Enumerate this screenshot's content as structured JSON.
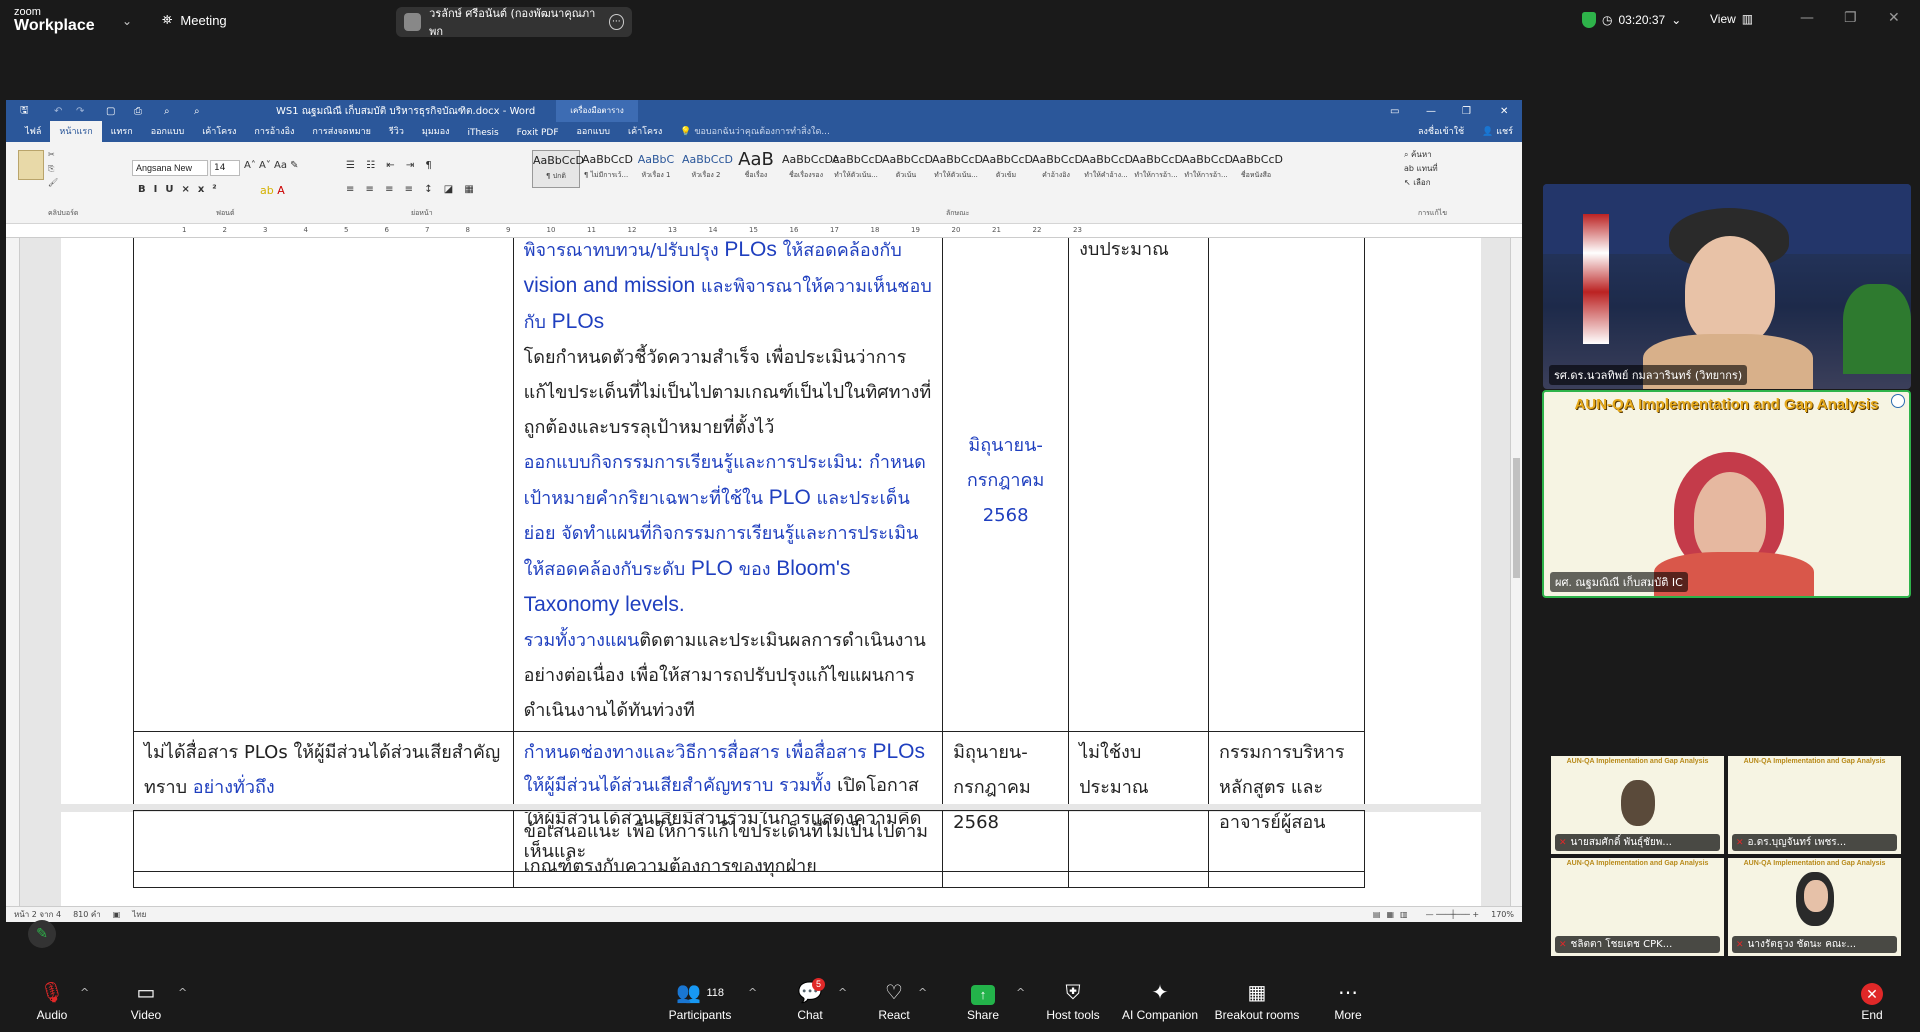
{
  "zoom": {
    "logo_line1": "zoom",
    "logo_line2": "Workplace",
    "meeting_label": "Meeting",
    "active_speaker": "วรลักษ์ ศรีอนันต์ (กองพัฒนาคุณภาพก",
    "timer": "03:20:37",
    "view_label": "View"
  },
  "word": {
    "title": "WS1 ณฐมณิณี เก็บสมบัติ บริหารธุรกิจบัณฑิต.docx  -  Word",
    "context_tab": "เครื่องมือตาราง",
    "tell_me": "ขอบอกฉันว่าคุณต้องการทำสิ่งใด...",
    "sign_in": "ลงชื่อเข้าใช้",
    "share": "แชร์",
    "tabs": [
      "ไฟล์",
      "หน้าแรก",
      "แทรก",
      "ออกแบบ",
      "เค้าโครง",
      "การอ้างอิง",
      "การส่งจดหมาย",
      "รีวิว",
      "มุมมอง",
      "iThesis",
      "Foxit PDF",
      "ออกแบบ",
      "เค้าโครง"
    ],
    "font_name": "Angsana New",
    "font_size": "14",
    "styles": [
      {
        "preview": "AaBbCcD",
        "name": "¶ ปกติ"
      },
      {
        "preview": "AaBbCcD",
        "name": "¶ ไม่มีการเว้..."
      },
      {
        "preview": "AaBbC",
        "name": "หัวเรื่อง 1"
      },
      {
        "preview": "AaBbCcD",
        "name": "หัวเรื่อง 2"
      },
      {
        "preview": "AaB",
        "name": "ชื่อเรื่อง"
      },
      {
        "preview": "AaBbCcDc",
        "name": "ชื่อเรื่องรอง"
      },
      {
        "preview": "AaBbCcD",
        "name": "ทำให้ตัวเน้น..."
      },
      {
        "preview": "AaBbCcD",
        "name": "ตัวเน้น"
      },
      {
        "preview": "AaBbCcD",
        "name": "ทำให้ตัวเน้น..."
      },
      {
        "preview": "AaBbCcD",
        "name": "ตัวเข้ม"
      },
      {
        "preview": "AaBbCcD",
        "name": "คำอ้างอิง"
      },
      {
        "preview": "AaBbCcD",
        "name": "ทำให้คำอ้าง..."
      },
      {
        "preview": "AaBbCcD",
        "name": "ทำให้การอ้า..."
      },
      {
        "preview": "AaBbCcD",
        "name": "ทำให้การอ้า..."
      },
      {
        "preview": "AaBbCcD",
        "name": "ชื่อหนังสือ"
      }
    ],
    "group_labels": [
      "คลิปบอร์ด",
      "ฟอนต์",
      "ย่อหน้า",
      "ลักษณะ",
      "การแก้ไข"
    ],
    "find_label": "ค้นหา",
    "replace_label": "แทนที่",
    "select_label": "เลือก",
    "ruler_numbers": [
      "1",
      "2",
      "3",
      "4",
      "5",
      "6",
      "7",
      "8",
      "9",
      "10",
      "11",
      "12",
      "13",
      "14",
      "15",
      "16",
      "17",
      "18",
      "19",
      "20",
      "21",
      "22",
      "23"
    ],
    "status": {
      "page": "หน้า 2 จาก 4",
      "words": "810 คำ",
      "lang": "ไทย",
      "zoom": "170%"
    },
    "table": {
      "row1": {
        "col2_lines": [
          {
            "t": "พิจารณาทบทวน/ปรับปรุง ",
            "blue": true
          },
          {
            "t": "PLOs",
            "blue": true,
            "lat": true
          },
          {
            "t": " ให้สอดคล้องกับ ",
            "blue": true
          },
          {
            "t": "vision and mission",
            "blue": true,
            "lat": true
          },
          {
            "t": " และพิจารณาให้ความเห็นชอบกับ ",
            "blue": true
          },
          {
            "t": "PLOs",
            "blue": true,
            "lat": true
          }
        ],
        "col2_para2": "โดยกำหนดตัวชี้วัดความสำเร็จ เพื่อประเมินว่าการแก้ไขประเด็นที่ไม่เป็นไปตามเกณฑ์เป็นไปในทิศทางที่ถูกต้องและบรรลุเป้าหมายที่ตั้งไว้",
        "col2_para3a": "ออกแบบกิจกรรมการเรียนรู้และการประเมิน: กำหนดเป้าหมายคำกริยาเฉพาะที่ใช้ใน ",
        "col2_para3b": "PLO",
        "col2_para3c": " และประเด็นย่อย จัดทำแผนที่กิจกรรมการเรียนรู้และการประเมินให้สอดคล้องกับระดับ ",
        "col2_para3d": "PLO",
        "col2_para3e": " ของ ",
        "col2_para3f": "Bloom's Taxonomy levels.",
        "col2_para4a": "รวมทั้งวางแผน",
        "col2_para4b": "ติดตามและประเมินผลการดำเนินงานอย่างต่อเนื่อง เพื่อให้สามารถปรับปรุงแก้ไขแผนการดำเนินงานได้ทันท่วงที",
        "col3": "มิถุนายน-กรกฎาคม 2568",
        "col4": "งบประมาณ"
      },
      "row2": {
        "col1a": "ไม่ได้สื่อสาร PLOs ให้ผู้มีส่วนได้ส่วนเสียสำคัญทราบ ",
        "col1b": "อย่างทั่วถึง",
        "col2a": "กำหนดช่องทางและวิธีการสื่อสาร เพื่อสื่อสาร ",
        "col2b": "PLOs",
        "col2c": " ให้ผู้มีส่วนได้ส่วนเสียสำคัญทราบ รวมทั้ง",
        "col2d": " เปิดโอกาสให้ผู้มีส่วนได้ส่วนเสียมีส่วนร่วมในการแสดงความคิดเห็นและ",
        "col3": "มิถุนายน-กรกฎาคม 2568",
        "col4": "ไม่ใช้งบประมาณ",
        "col5": "กรรมการบริหารหลักสูตร และอาจารย์ผู้สอน"
      },
      "row3": {
        "col2": "ข้อเสนอแนะ เพื่อให้การแก้ไขประเด็นที่ไม่เป็นไปตามเกณฑ์ตรงกับความต้องการของทุกฝ่าย"
      }
    }
  },
  "videos": {
    "main1_name": "รศ.ดร.นวลทิพย์ กมลวารินทร์ (วิทยากร)",
    "main2_banner": "AUN-QA Implementation and Gap Analysis",
    "main2_name": "ผศ. ณฐมณิณี เก็บสมบัติ IC",
    "thumb_banner": "AUN-QA Implementation and Gap Analysis",
    "thumbs": [
      {
        "name": "นายสมศักดิ์ พันธ์ุชัยพ..."
      },
      {
        "name": "อ.ดร.บุญจันทร์ เพชร..."
      },
      {
        "name": "ชลิตตา โชยเดช CPK..."
      },
      {
        "name": "นางรัตธุวง ชัดนะ คณะ..."
      }
    ]
  },
  "toolbar": {
    "audio": "Audio",
    "video": "Video",
    "participants": "Participants",
    "participants_count": "118",
    "chat": "Chat",
    "chat_badge": "5",
    "react": "React",
    "share": "Share",
    "host_tools": "Host tools",
    "ai": "AI Companion",
    "breakout": "Breakout rooms",
    "more": "More",
    "end": "End"
  }
}
